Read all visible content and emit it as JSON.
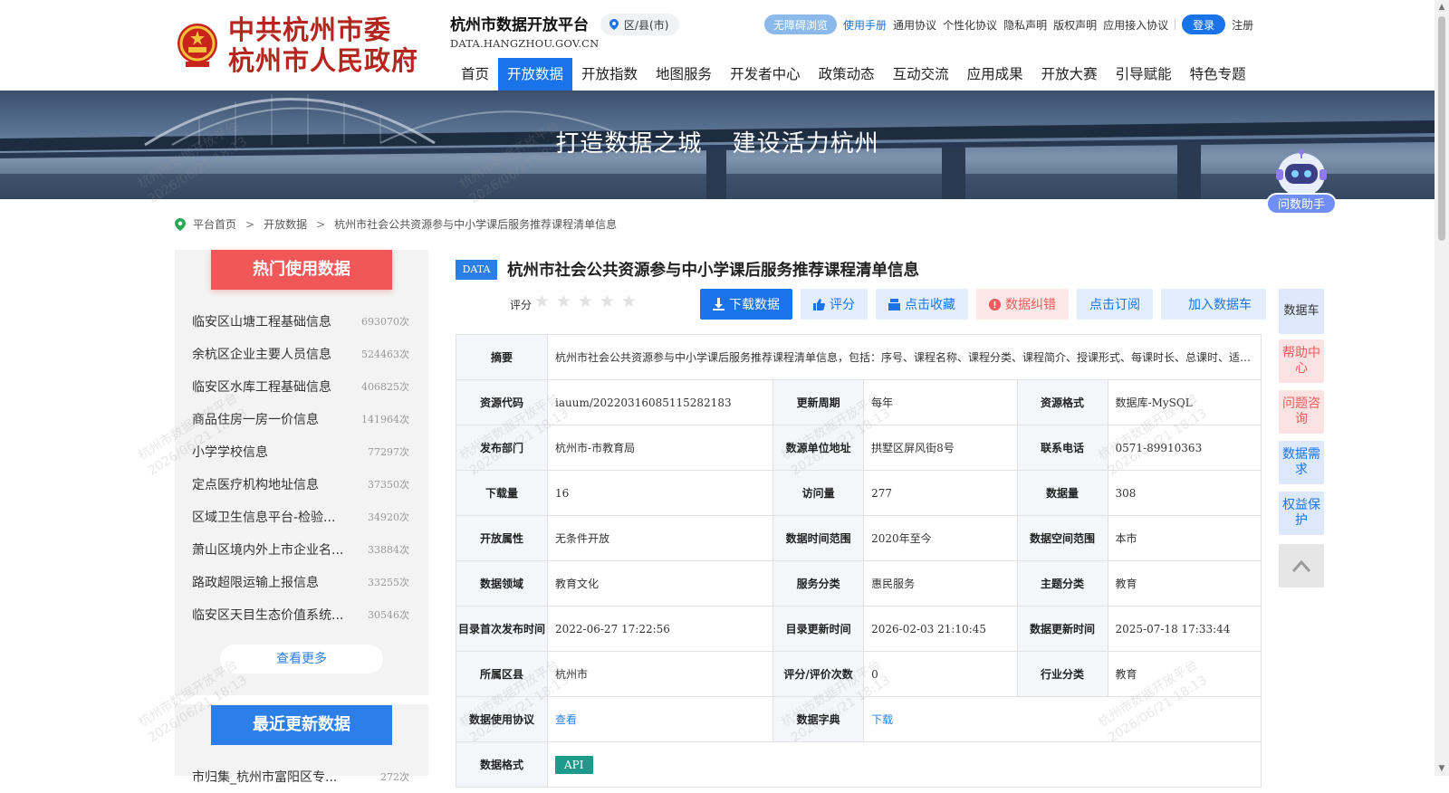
{
  "header": {
    "gov_line1": "中共杭州市委",
    "gov_line2": "杭州市人民政府",
    "platform_name": "杭州市数据开放平台",
    "district_label": "区/县(市)",
    "domain": "DATA.HANGZHOU.GOV.CN",
    "utility": {
      "accessibility": "无障碍浏览",
      "manual": "使用手册",
      "general_agreement": "通用协议",
      "personal_agreement": "个性化协议",
      "privacy": "隐私声明",
      "copyright": "版权声明",
      "app_access": "应用接入协议",
      "login": "登录",
      "register": "注册"
    },
    "nav": [
      "首页",
      "开放数据",
      "开放指数",
      "地图服务",
      "开发者中心",
      "政策动态",
      "互动交流",
      "应用成果",
      "开放大赛",
      "引导赋能",
      "特色专题"
    ],
    "active_nav": "开放数据"
  },
  "banner": {
    "slogan_left": "打造数据之城",
    "slogan_right": "建设活力杭州"
  },
  "assistant_label": "问数助手",
  "breadcrumb": [
    "平台首页",
    "开放数据",
    "杭州市社会公共资源参与中小学课后服务推荐课程清单信息"
  ],
  "hot": {
    "title": "热门使用数据",
    "items": [
      {
        "name": "临安区山塘工程基础信息",
        "count": "693070次"
      },
      {
        "name": "余杭区企业主要人员信息",
        "count": "524463次"
      },
      {
        "name": "临安区水库工程基础信息",
        "count": "406825次"
      },
      {
        "name": "商品住房一房一价信息",
        "count": "141964次"
      },
      {
        "name": "小学学校信息",
        "count": "77297次"
      },
      {
        "name": "定点医疗机构地址信息",
        "count": "37350次"
      },
      {
        "name": "区域卫生信息平台-检验...",
        "count": "34920次"
      },
      {
        "name": "萧山区境内外上市企业名...",
        "count": "33884次"
      },
      {
        "name": "路政超限运输上报信息",
        "count": "33255次"
      },
      {
        "name": "临安区天目生态价值系统...",
        "count": "30546次"
      }
    ],
    "more": "查看更多"
  },
  "recent": {
    "title": "最近更新数据",
    "first_item": {
      "name": "市归集_杭州市富阳区专...",
      "count": "272次"
    }
  },
  "detail": {
    "badge": "DATA",
    "title": "杭州市社会公共资源参与中小学课后服务推荐课程清单信息",
    "rating_label": "评分",
    "rating_stars": 0,
    "actions": {
      "download": "下载数据",
      "rate": "评分",
      "favorite": "点击收藏",
      "error": "数据纠错",
      "subscribe": "点击订阅",
      "add_cart": "加入数据车"
    },
    "summary_label": "摘要",
    "summary": "杭州市社会公共资源参与中小学课后服务推荐课程清单信息，包括：序号、课程名称、课程分类、课程简介、授课形式、每课时长、总课时、适用年级、收费标准、联系人、联系电话等",
    "rows": [
      [
        {
          "k": "资源代码",
          "v": "iauum/20220316085115282183"
        },
        {
          "k": "更新周期",
          "v": "每年"
        },
        {
          "k": "资源格式",
          "v": "数据库-MySQL"
        }
      ],
      [
        {
          "k": "发布部门",
          "v": "杭州市-市教育局"
        },
        {
          "k": "数源单位地址",
          "v": "拱墅区屏风街8号"
        },
        {
          "k": "联系电话",
          "v": "0571-89910363"
        }
      ],
      [
        {
          "k": "下载量",
          "v": "16"
        },
        {
          "k": "访问量",
          "v": "277"
        },
        {
          "k": "数据量",
          "v": "308"
        }
      ],
      [
        {
          "k": "开放属性",
          "v": "无条件开放"
        },
        {
          "k": "数据时间范围",
          "v": "2020年至今"
        },
        {
          "k": "数据空间范围",
          "v": "本市"
        }
      ],
      [
        {
          "k": "数据领域",
          "v": "教育文化"
        },
        {
          "k": "服务分类",
          "v": "惠民服务"
        },
        {
          "k": "主题分类",
          "v": "教育"
        }
      ],
      [
        {
          "k": "目录首次发布时间",
          "v": "2022-06-27 17:22:56"
        },
        {
          "k": "目录更新时间",
          "v": "2026-02-03 21:10:45"
        },
        {
          "k": "数据更新时间",
          "v": "2025-07-18 17:33:44"
        }
      ],
      [
        {
          "k": "所属区县",
          "v": "杭州市"
        },
        {
          "k": "评分/评价次数",
          "v": "0"
        },
        {
          "k": "行业分类",
          "v": "教育"
        }
      ]
    ],
    "usage_label": "数据使用协议",
    "usage_link": "查看",
    "dict_label": "数据字典",
    "dict_link": "下载",
    "format_label": "数据格式",
    "format_tag": "API"
  },
  "side_float": {
    "cart": "数据车",
    "help": "帮助中心",
    "consult": "问题咨询",
    "demand": "数据需求",
    "rights": "权益保护"
  },
  "watermark": {
    "line1": "杭州市数据开放平台",
    "line2": "2026/06/21 18:13"
  },
  "colors": {
    "primary": "#1a73e8",
    "hot_red": "#f25757",
    "gov_red": "#b5261e",
    "api_teal": "#1e9a8c"
  }
}
